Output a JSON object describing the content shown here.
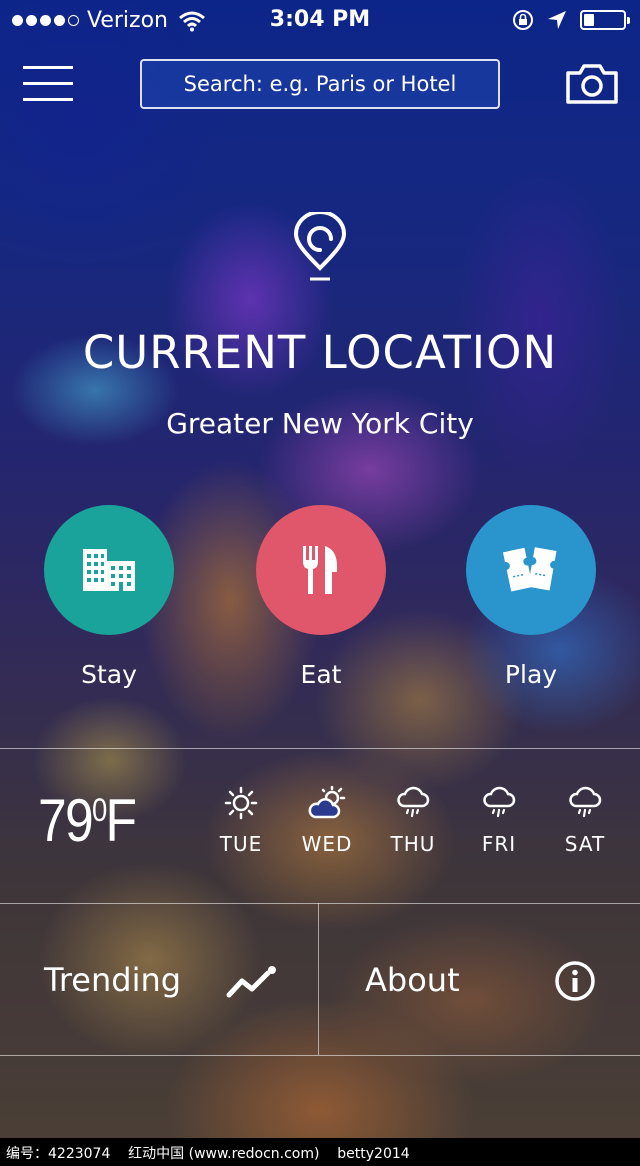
{
  "status_bar": {
    "carrier": "Verizon",
    "time": "3:04 PM",
    "battery_level": 0.25
  },
  "header": {
    "menu_icon": "hamburger-menu-icon",
    "search_placeholder": "Search: e.g. Paris or Hotel",
    "camera_icon": "camera-icon"
  },
  "location": {
    "icon": "map-pin-icon",
    "title": "CURRENT LOCATION",
    "name": "Greater New York City"
  },
  "categories": [
    {
      "label": "Stay",
      "icon": "hotel-building-icon",
      "color": "#1aa39a"
    },
    {
      "label": "Eat",
      "icon": "fork-knife-icon",
      "color": "#e0566a"
    },
    {
      "label": "Play",
      "icon": "ticket-icon",
      "color": "#2a95cc"
    }
  ],
  "weather": {
    "temperature": "79",
    "degree": "0",
    "unit": "F",
    "forecast": [
      {
        "day": "TUE",
        "icon": "sun-icon"
      },
      {
        "day": "WED",
        "icon": "partly-cloudy-icon"
      },
      {
        "day": "THU",
        "icon": "rain-cloud-icon"
      },
      {
        "day": "FRI",
        "icon": "rain-cloud-icon"
      },
      {
        "day": "SAT",
        "icon": "rain-cloud-icon"
      }
    ]
  },
  "links": {
    "trending": "Trending",
    "about": "About"
  },
  "watermark": "编号：4223074    红动中国 (www.redocn.com)    betty2014"
}
